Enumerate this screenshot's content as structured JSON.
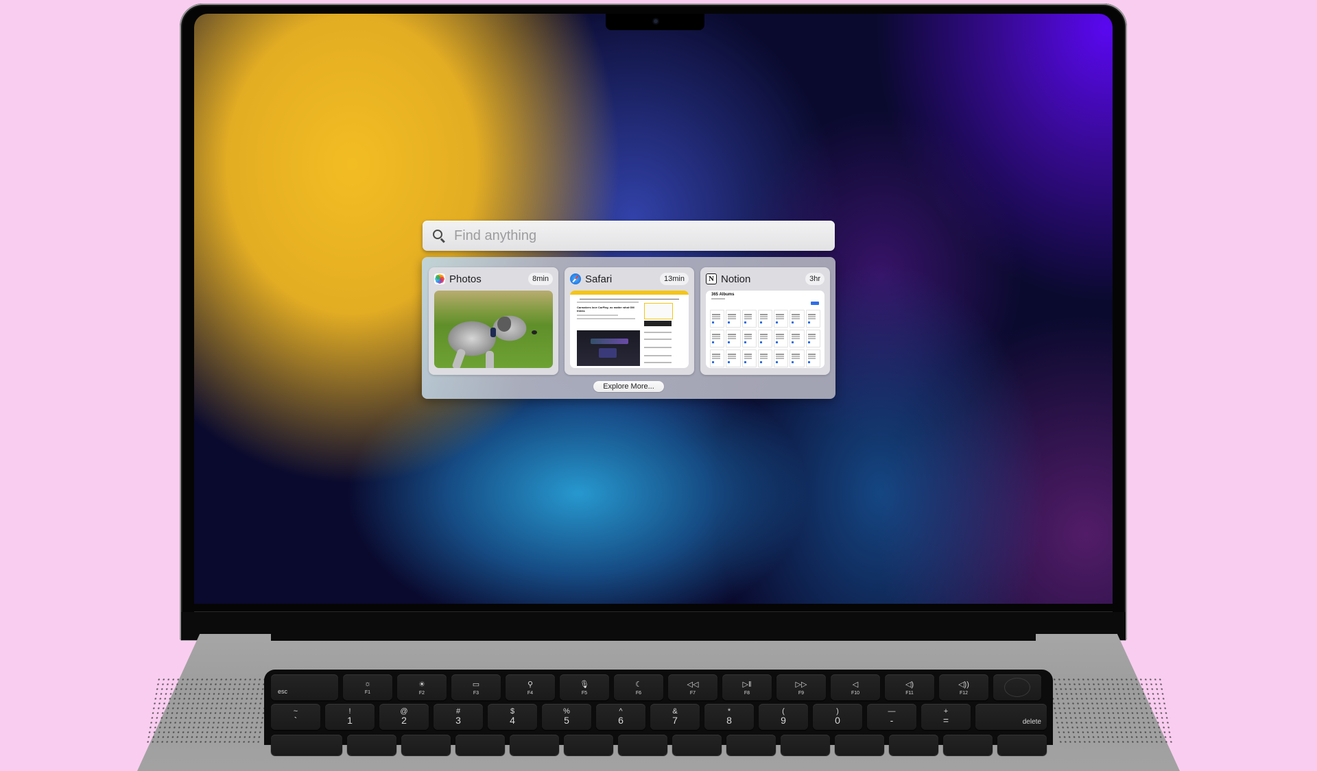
{
  "search": {
    "placeholder": "Find anything",
    "value": "",
    "icon": "search-icon"
  },
  "results": [
    {
      "app": "Photos",
      "icon": "photos-icon",
      "elapsed": "8min",
      "preview": "photo of a gray dog on grass"
    },
    {
      "app": "Safari",
      "icon": "safari-icon",
      "elapsed": "13min",
      "preview": "article page",
      "headline": "Carmakers love CarPlay, no matter what GM thinks"
    },
    {
      "app": "Notion",
      "icon": "notion-icon",
      "elapsed": "3hr",
      "preview": "calendar page",
      "page_title": "365 Albums"
    }
  ],
  "explore_more_label": "Explore More...",
  "keyboard": {
    "function_row": [
      {
        "label": "esc",
        "icon": ""
      },
      {
        "label": "F1",
        "icon": "☼"
      },
      {
        "label": "F2",
        "icon": "☀"
      },
      {
        "label": "F3",
        "icon": "▭"
      },
      {
        "label": "F4",
        "icon": "⚲"
      },
      {
        "label": "F5",
        "icon": "🎙"
      },
      {
        "label": "F6",
        "icon": "☾"
      },
      {
        "label": "F7",
        "icon": "◁◁"
      },
      {
        "label": "F8",
        "icon": "▷‖"
      },
      {
        "label": "F9",
        "icon": "▷▷"
      },
      {
        "label": "F10",
        "icon": "◁"
      },
      {
        "label": "F11",
        "icon": "◁)"
      },
      {
        "label": "F12",
        "icon": "◁))"
      }
    ],
    "number_row": [
      {
        "shift": "~",
        "base": "`"
      },
      {
        "shift": "!",
        "base": "1"
      },
      {
        "shift": "@",
        "base": "2"
      },
      {
        "shift": "#",
        "base": "3"
      },
      {
        "shift": "$",
        "base": "4"
      },
      {
        "shift": "%",
        "base": "5"
      },
      {
        "shift": "^",
        "base": "6"
      },
      {
        "shift": "&",
        "base": "7"
      },
      {
        "shift": "*",
        "base": "8"
      },
      {
        "shift": "(",
        "base": "9"
      },
      {
        "shift": ")",
        "base": "0"
      },
      {
        "shift": "—",
        "base": "-"
      },
      {
        "shift": "+",
        "base": "="
      }
    ],
    "delete_label": "delete"
  }
}
